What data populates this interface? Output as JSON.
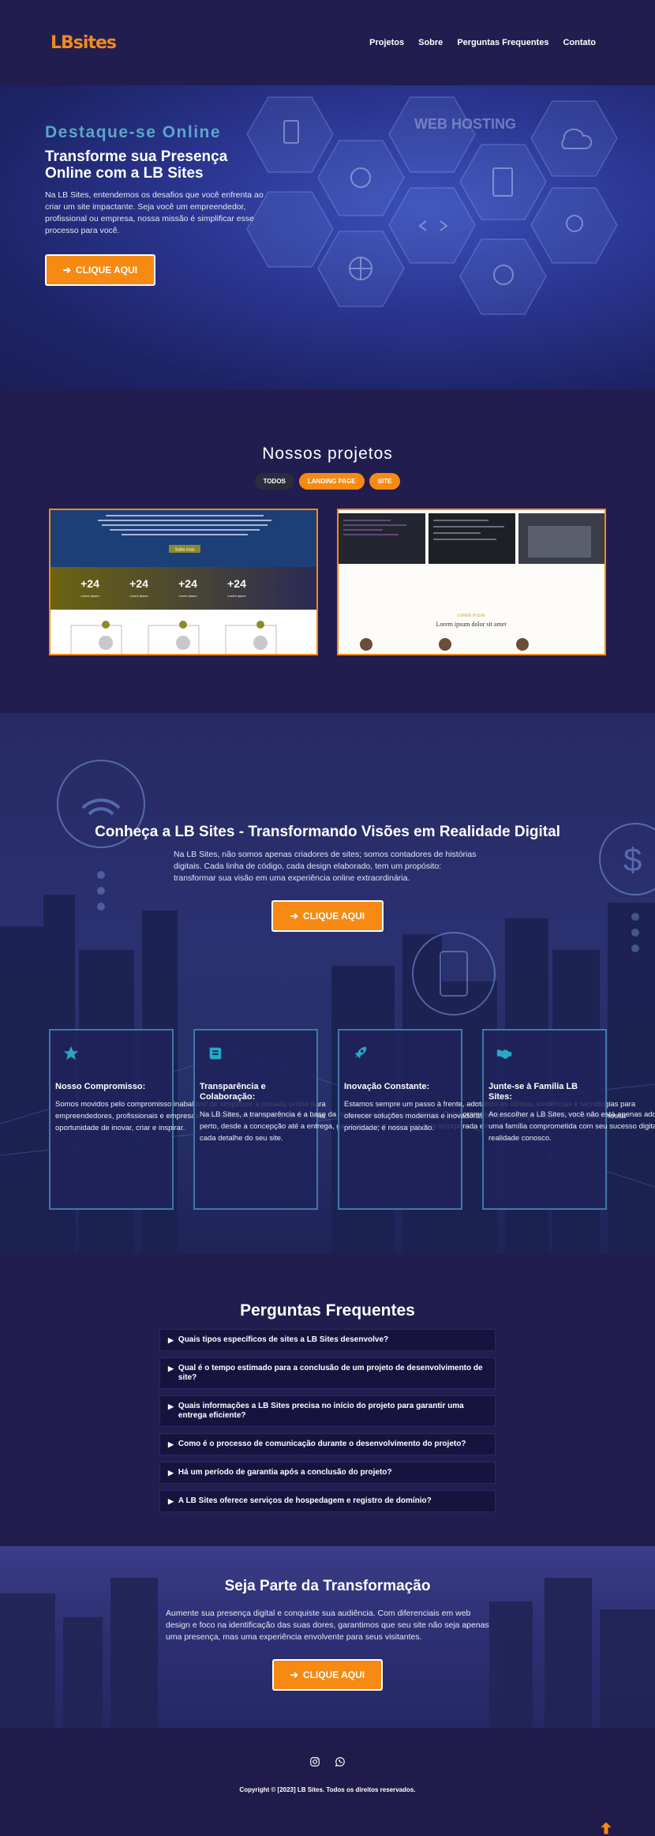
{
  "header": {
    "logo": "LBsites",
    "nav": [
      "Projetos",
      "Sobre",
      "Perguntas Frequentes",
      "Contato"
    ]
  },
  "hero": {
    "eyebrow": "Destaque-se Online",
    "title": "Transforme sua Presença Online com a LB Sites",
    "text": "Na LB Sites, entendemos os desafios que você enfrenta ao criar um site impactante. Seja você um empreendedor, profissional ou empresa, nossa missão é simplificar esse processo para você.",
    "button": "CLIQUE AQUI",
    "image_text": "WEB HOSTING"
  },
  "projects": {
    "title": "Nossos projetos",
    "filters": [
      "TODOS",
      "LANDING PAGE",
      "SITE"
    ],
    "card1": {
      "button": "Saiba mais",
      "stats": [
        "+24",
        "+24",
        "+24",
        "+24"
      ],
      "stat_label": "Lorem ipsum"
    },
    "card2": {
      "kicker": "LOREM IPSUM",
      "title": "Lorem ipsum dolor sit amet"
    }
  },
  "about": {
    "title": "Conheça a LB Sites - Transformando Visões em Realidade Digital",
    "text": "Na LB Sites, não somos apenas criadores de sites; somos contadores de histórias digitais. Cada linha de código, cada design elaborado, tem um propósito: transformar sua visão em uma experiência online extraordinária.",
    "button": "CLIQUE AQUI",
    "features": [
      {
        "icon": "star-icon",
        "title": "Nosso Compromisso:",
        "text": "Somos movidos pelo compromisso inabalável de simplificar a jornada online para empreendedores, profissionais e empresas. Acreditamos que cada projeto é uma oportunidade de inovar, criar e inspirar."
      },
      {
        "icon": "scroll-icon",
        "title": "Transparência e Colaboração:",
        "text": "Na LB Sites, a transparência é a base da nossa relação com os clientes. Colaboramos de perto, desde a concepção até a entrega, garantindo que sua visão seja incorporada em cada detalhe do seu site."
      },
      {
        "icon": "rocket-icon",
        "title": "Inovação Constante:",
        "text": "Estamos sempre um passo à frente, adotando as últimas tendências e tecnologias para oferecer soluções modernas e inovadoras. Sua presença online não é apenas nossa prioridade; é nossa paixão."
      },
      {
        "icon": "handshake-icon",
        "title": "Junte-se à Família LB Sites:",
        "text": "Ao escolher a LB Sites, você não está apenas adquirindo um serviço; está ingressando em uma família comprometida com seu sucesso digital. Transforme suas expectativas em realidade conosco."
      }
    ]
  },
  "faq": {
    "title": "Perguntas Frequentes",
    "items": [
      "Quais tipos específicos de sites a LB Sites desenvolve?",
      "Qual é o tempo estimado para a conclusão de um projeto de desenvolvimento de site?",
      "Quais informações a LB Sites precisa no início do projeto para garantir uma entrega eficiente?",
      "Como é o processo de comunicação durante o desenvolvimento do projeto?",
      "Há um período de garantia após a conclusão do projeto?",
      "A LB Sites oferece serviços de hospedagem e registro de domínio?"
    ]
  },
  "cta": {
    "title": "Seja Parte da Transformação",
    "text": "Aumente sua presença digital e conquiste sua audiência. Com diferenciais em web design e foco na identificação das suas dores, garantimos que seu site não seja apenas uma presença, mas uma experiência envolvente para seus visitantes.",
    "button": "CLIQUE AQUI"
  },
  "footer": {
    "social": [
      "instagram-icon",
      "whatsapp-icon"
    ],
    "copyright": "Copyright © [2023] LB Sites. Todos os direitos reservados."
  },
  "colors": {
    "background": "#221d4f",
    "accent": "#f68a12",
    "eyebrow": "#5aa6c8",
    "feature_icon": "#2aa7c6"
  }
}
